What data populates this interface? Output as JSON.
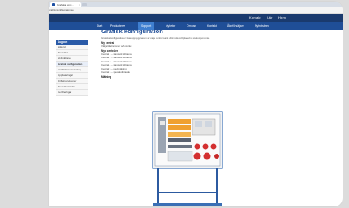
{
  "browser": {
    "tab_title": "Grafiska konfi... ",
    "tab_close": "×",
    "address": "grafisk.konfiguration.se"
  },
  "top_links": [
    "Kontakt",
    "Lär",
    "Hem"
  ],
  "nav": {
    "items": [
      "Start",
      "Produkter",
      "Support",
      "Nyheter",
      "Om oss",
      "Kontakt",
      "Återförsäljare",
      "Nyhetsbrev"
    ],
    "active": "Support",
    "dropdown_icon": "chevron-down-icon"
  },
  "sidebar": {
    "heading": "Support",
    "items": [
      "Sökord",
      "Produkter",
      "El-funktioner",
      "Grafisk konfiguration",
      "Installationsanvisning",
      "Uppdateringar",
      "Driftsinstruktioner",
      "Produktdatablad",
      "Certifieringar"
    ],
    "active_index": 3
  },
  "main": {
    "title": "Grafisk konfiguration",
    "intro": "Grafiska konfigurationer visar uppbyggnaden av varje central samt utförande och placering av komponenter.",
    "section1": "Ny central",
    "section1_line": "Välj artikelnummer och storlek",
    "section2": "Nya centraler",
    "lines": [
      "Central 1 – standard utförande",
      "Central 2 – standard utförande",
      "Central 3 – standard utförande",
      "Central 4 – standard utförande",
      "Central 5 – med mätning",
      "Central 6 – specialutförande"
    ],
    "section3": "Mätning"
  },
  "colors": {
    "nav_bg": "#1f4e97",
    "top_bg": "#1a3a6e",
    "accent": "#3f7fd0",
    "socket_red": "#d32f2f",
    "breaker_orange": "#f0a030"
  }
}
